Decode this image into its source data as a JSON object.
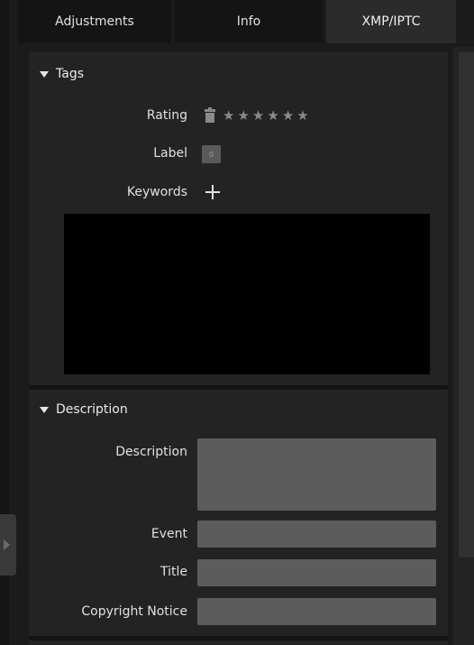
{
  "tabs": [
    {
      "label": "Adjustments",
      "active": false
    },
    {
      "label": "Info",
      "active": false
    },
    {
      "label": "XMP/IPTC",
      "active": true
    }
  ],
  "tags_section": {
    "title": "Tags",
    "rating_label": "Rating",
    "rating_stars": [
      "★",
      "★",
      "★",
      "★",
      "★",
      "★"
    ],
    "rating_value": 0,
    "label_label": "Label",
    "label_value": "0",
    "keywords_label": "Keywords",
    "keywords": []
  },
  "description_section": {
    "title": "Description",
    "description_label": "Description",
    "description_value": "",
    "event_label": "Event",
    "event_value": "",
    "title_label": "Title",
    "title_value": "",
    "copyright_label": "Copyright Notice",
    "copyright_value": ""
  },
  "colors": {
    "panel_bg": "#232323",
    "field_bg": "#5c5c5c",
    "active_tab_bg": "#2b2b2b",
    "keywords_box_bg": "#000000"
  },
  "icons": {
    "collapse": "triangle-down-icon",
    "clear_rating": "trash-icon",
    "star": "star-icon",
    "add_keyword": "plus-icon",
    "side_handle": "chevron-right-icon"
  }
}
